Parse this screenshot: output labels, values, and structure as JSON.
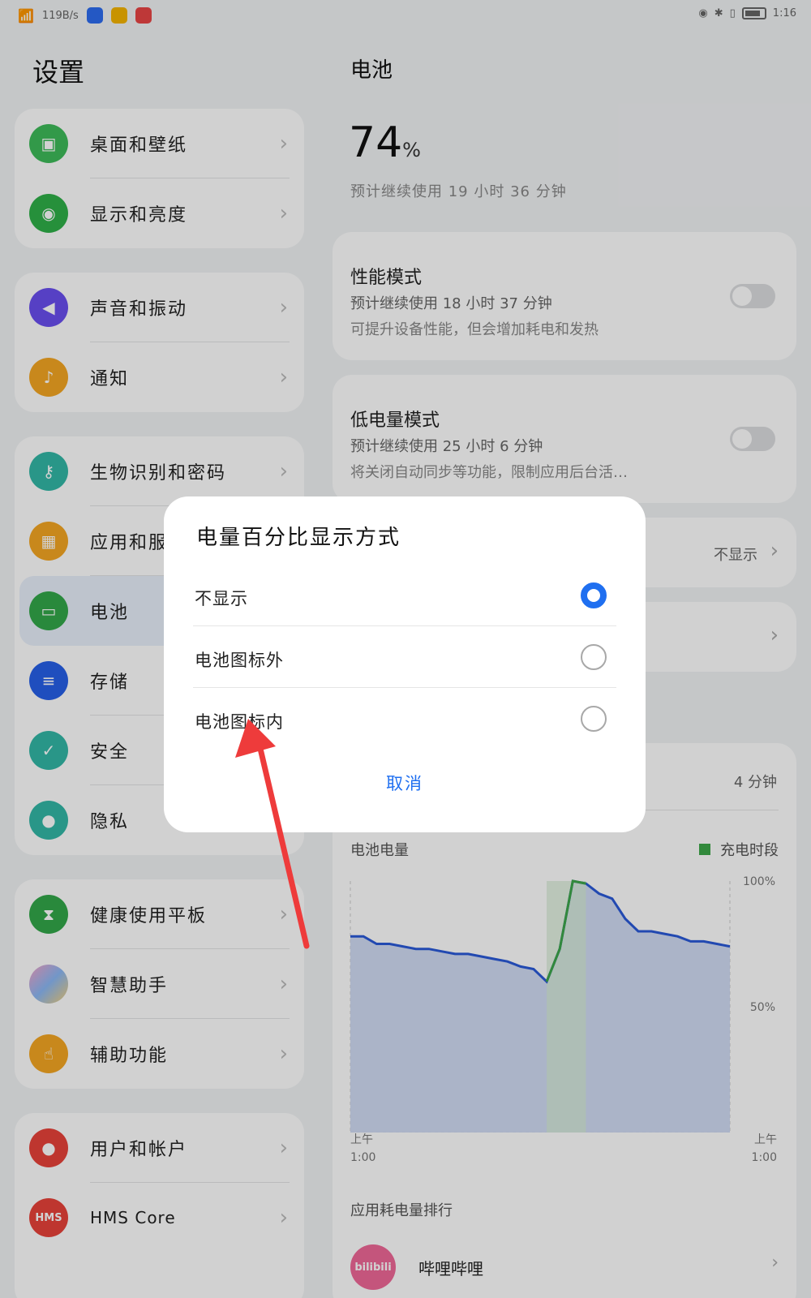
{
  "status_bar": {
    "signal": "⁶",
    "network_speed": "119B/s",
    "time": "1:16"
  },
  "left": {
    "title": "设置",
    "groups": [
      {
        "items": [
          {
            "label": "桌面和壁纸",
            "icon": "wallpaper-icon",
            "color": "#3dbb5a"
          },
          {
            "label": "显示和亮度",
            "icon": "eye-icon",
            "color": "#2fb049"
          }
        ]
      },
      {
        "items": [
          {
            "label": "声音和振动",
            "icon": "speaker-icon",
            "color": "#6a4ff0"
          },
          {
            "label": "通知",
            "icon": "bell-icon",
            "color": "#f5a623"
          }
        ]
      },
      {
        "items": [
          {
            "label": "生物识别和密码",
            "icon": "key-icon",
            "color": "#33b7a6"
          },
          {
            "label": "应用和服",
            "icon": "apps-icon",
            "color": "#f5a623"
          },
          {
            "label": "电池",
            "icon": "battery-icon",
            "color": "#33a84a"
          },
          {
            "label": "存储",
            "icon": "storage-icon",
            "color": "#2760e8"
          },
          {
            "label": "安全",
            "icon": "shield-icon",
            "color": "#33b7a6"
          },
          {
            "label": "隐私",
            "icon": "privacy-icon",
            "color": "#33b7a6"
          }
        ]
      },
      {
        "items": [
          {
            "label": "健康使用平板",
            "icon": "hourglass-icon",
            "color": "#33a84a"
          },
          {
            "label": "智慧助手",
            "icon": "assistant-icon",
            "color": "#b07be8"
          },
          {
            "label": "辅助功能",
            "icon": "hand-icon",
            "color": "#f5a623"
          }
        ]
      },
      {
        "items": [
          {
            "label": "用户和帐户",
            "icon": "user-icon",
            "color": "#e8433a"
          },
          {
            "label": "HMS Core",
            "icon": "hms-icon",
            "color": "#e8433a"
          }
        ]
      }
    ]
  },
  "right": {
    "title": "电池",
    "percent": "74",
    "percent_unit": "%",
    "estimate": "预计继续使用  19  小时  36  分钟",
    "performance": {
      "title": "性能模式",
      "estimate": "预计继续使用  18  小时  37  分钟",
      "desc": "可提升设备性能，但会增加耗电和发热"
    },
    "low_power": {
      "title": "低电量模式",
      "estimate": "预计继续使用  25  小时  6  分钟",
      "desc": "将关闭自动同步等功能，限制应用后台活…"
    },
    "pct_display_value": "不显示",
    "usage_value": "4  分钟",
    "chart_label": "电池电量",
    "legend_label": "充电时段",
    "ranking_title": "应用耗电量排行",
    "app_name": "哔哩哔哩",
    "app_badge": "bilibili"
  },
  "dialog": {
    "title": "电量百分比显示方式",
    "options": [
      {
        "label": "不显示",
        "selected": true
      },
      {
        "label": "电池图标外",
        "selected": false
      },
      {
        "label": "电池图标内",
        "selected": false
      }
    ],
    "cancel": "取消"
  },
  "chart_data": {
    "type": "area",
    "xlabel_left": "上午\n1:00",
    "xlabel_right": "上午\n1:00",
    "yticks": [
      "100%",
      "50%"
    ],
    "ylim": [
      0,
      100
    ],
    "series": [
      {
        "name": "电池电量",
        "values": [
          78,
          78,
          75,
          75,
          74,
          73,
          73,
          72,
          71,
          71,
          70,
          69,
          68,
          66,
          65,
          60,
          73,
          100,
          99,
          95,
          93,
          85,
          80,
          80,
          79,
          78,
          76,
          76,
          75,
          74
        ]
      },
      {
        "name": "充电时段",
        "values": [
          60,
          73,
          100,
          99
        ]
      }
    ],
    "colors": {
      "line": "#2a5ad8",
      "charge": "#3ea84a",
      "fill": "#c9d6f3"
    }
  }
}
